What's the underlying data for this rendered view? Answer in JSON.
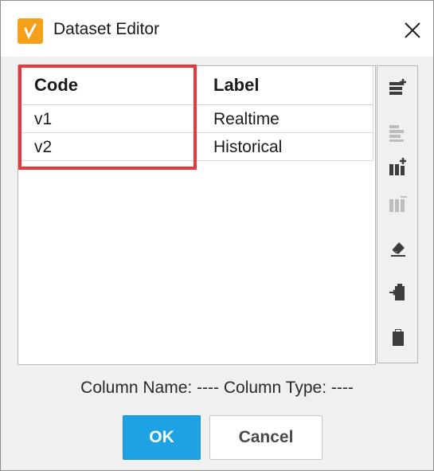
{
  "window": {
    "title": "Dataset Editor",
    "icon": "dataset-editor-icon",
    "close_icon": "close-icon"
  },
  "table": {
    "columns": [
      "Code",
      "Label"
    ],
    "rows": [
      [
        "v1",
        "Realtime"
      ],
      [
        "v2",
        "Historical"
      ]
    ]
  },
  "toolbar": {
    "icons": [
      "add-row-icon",
      "remove-row-icon",
      "add-column-icon",
      "remove-column-icon",
      "clear-icon",
      "import-icon",
      "paste-icon"
    ]
  },
  "footer": {
    "column_info": "Column Name: ----  Column Type: ----"
  },
  "buttons": {
    "ok": "OK",
    "cancel": "Cancel"
  },
  "colors": {
    "accent": "#1fa2e3",
    "highlight": "#e5393d",
    "app_icon": "#f6a01a"
  }
}
